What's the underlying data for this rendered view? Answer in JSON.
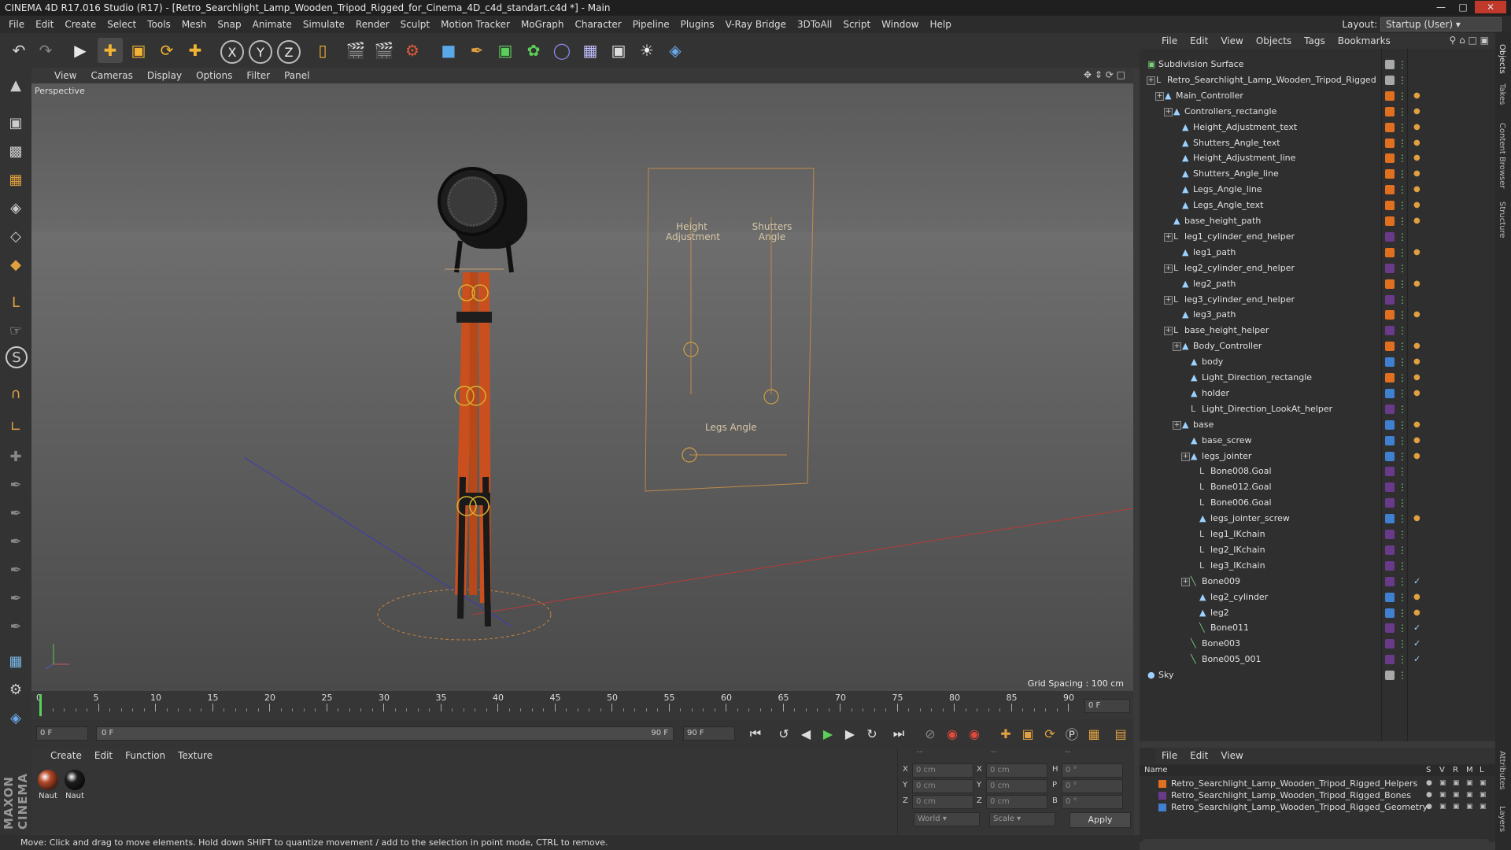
{
  "title": "CINEMA 4D R17.016 Studio (R17) - [Retro_Searchlight_Lamp_Wooden_Tripod_Rigged_for_Cinema_4D_c4d_standart.c4d *] - Main",
  "menubar": [
    "File",
    "Edit",
    "Create",
    "Select",
    "Tools",
    "Mesh",
    "Snap",
    "Animate",
    "Simulate",
    "Render",
    "Sculpt",
    "Motion Tracker",
    "MoGraph",
    "Character",
    "Pipeline",
    "Plugins",
    "V-Ray Bridge",
    "3DToAll",
    "Script",
    "Window",
    "Help"
  ],
  "layout": {
    "label": "Layout:",
    "value": "Startup (User)"
  },
  "viewport_menu": [
    "View",
    "Cameras",
    "Display",
    "Options",
    "Filter",
    "Panel"
  ],
  "viewport": {
    "label": "Perspective",
    "grid_spacing": "Grid Spacing : 100 cm",
    "overlay": {
      "height": "Height Adjustment",
      "shutters": "Shutters Angle",
      "legs": "Legs Angle"
    }
  },
  "timeline": {
    "ticks": [
      "0",
      "5",
      "10",
      "15",
      "20",
      "25",
      "30",
      "35",
      "40",
      "45",
      "50",
      "55",
      "60",
      "65",
      "70",
      "75",
      "80",
      "85",
      "90"
    ],
    "end_frame": "0 F",
    "start_field": "0 F",
    "range_start": "0 F",
    "range_end": "90 F",
    "max_field": "90 F"
  },
  "material_menu": [
    "Create",
    "Edit",
    "Function",
    "Texture"
  ],
  "materials": [
    {
      "name": "Naut",
      "color": "#b54a2a"
    },
    {
      "name": "Naut",
      "color": "#1d1d1d"
    }
  ],
  "coords": {
    "rows": [
      {
        "a": "X",
        "av": "0 cm",
        "b": "X",
        "bv": "0 cm",
        "c": "H",
        "cv": "0 °"
      },
      {
        "a": "Y",
        "av": "0 cm",
        "b": "Y",
        "bv": "0 cm",
        "c": "P",
        "cv": "0 °"
      },
      {
        "a": "Z",
        "av": "0 cm",
        "b": "Z",
        "bv": "0 cm",
        "c": "B",
        "cv": "0 °"
      }
    ],
    "header": [
      "--",
      "--",
      "--"
    ],
    "space": "World",
    "mode": "Scale",
    "apply": "Apply"
  },
  "status": "Move: Click and drag to move elements. Hold down SHIFT to quantize movement / add to the selection in point mode, CTRL to remove.",
  "object_menu": [
    "File",
    "Edit",
    "View",
    "Objects",
    "Tags",
    "Bookmarks"
  ],
  "objects": [
    {
      "name": "Subdivision Surface",
      "depth": 0,
      "icon": "subdiv",
      "color": "#a8a8a8"
    },
    {
      "name": "Retro_Searchlight_Lamp_Wooden_Tripod_Rigged",
      "depth": 1,
      "icon": "null",
      "color": "#a8a8a8"
    },
    {
      "name": "Main_Controller",
      "depth": 2,
      "icon": "spline",
      "color": "#e07020"
    },
    {
      "name": "Controllers_rectangle",
      "depth": 3,
      "icon": "spline",
      "color": "#e07020"
    },
    {
      "name": "Height_Adjustment_text",
      "depth": 4,
      "icon": "spline",
      "color": "#e07020"
    },
    {
      "name": "Shutters_Angle_text",
      "depth": 4,
      "icon": "spline",
      "color": "#e07020"
    },
    {
      "name": "Height_Adjustment_line",
      "depth": 4,
      "icon": "spline",
      "color": "#e07020"
    },
    {
      "name": "Shutters_Angle_line",
      "depth": 4,
      "icon": "spline",
      "color": "#e07020"
    },
    {
      "name": "Legs_Angle_line",
      "depth": 4,
      "icon": "spline",
      "color": "#e07020"
    },
    {
      "name": "Legs_Angle_text",
      "depth": 4,
      "icon": "spline",
      "color": "#e07020"
    },
    {
      "name": "base_height_path",
      "depth": 3,
      "icon": "spline",
      "color": "#e07020"
    },
    {
      "name": "leg1_cylinder_end_helper",
      "depth": 3,
      "icon": "null",
      "color": "#6a3a8a"
    },
    {
      "name": "leg1_path",
      "depth": 4,
      "icon": "spline",
      "color": "#e07020"
    },
    {
      "name": "leg2_cylinder_end_helper",
      "depth": 3,
      "icon": "null",
      "color": "#6a3a8a"
    },
    {
      "name": "leg2_path",
      "depth": 4,
      "icon": "spline",
      "color": "#e07020"
    },
    {
      "name": "leg3_cylinder_end_helper",
      "depth": 3,
      "icon": "null",
      "color": "#6a3a8a"
    },
    {
      "name": "leg3_path",
      "depth": 4,
      "icon": "spline",
      "color": "#e07020"
    },
    {
      "name": "base_height_helper",
      "depth": 3,
      "icon": "null",
      "color": "#6a3a8a"
    },
    {
      "name": "Body_Controller",
      "depth": 4,
      "icon": "spline",
      "color": "#e07020"
    },
    {
      "name": "body",
      "depth": 5,
      "icon": "poly",
      "color": "#4080d0"
    },
    {
      "name": "Light_Direction_rectangle",
      "depth": 5,
      "icon": "spline",
      "color": "#e07020"
    },
    {
      "name": "holder",
      "depth": 5,
      "icon": "poly",
      "color": "#4080d0"
    },
    {
      "name": "Light_Direction_LookAt_helper",
      "depth": 5,
      "icon": "null",
      "color": "#6a3a8a"
    },
    {
      "name": "base",
      "depth": 4,
      "icon": "poly",
      "color": "#4080d0"
    },
    {
      "name": "base_screw",
      "depth": 5,
      "icon": "poly",
      "color": "#4080d0"
    },
    {
      "name": "legs_jointer",
      "depth": 5,
      "icon": "poly",
      "color": "#4080d0"
    },
    {
      "name": "Bone008.Goal",
      "depth": 6,
      "icon": "null",
      "color": "#6a3a8a"
    },
    {
      "name": "Bone012.Goal",
      "depth": 6,
      "icon": "null",
      "color": "#6a3a8a"
    },
    {
      "name": "Bone006.Goal",
      "depth": 6,
      "icon": "null",
      "color": "#6a3a8a"
    },
    {
      "name": "legs_jointer_screw",
      "depth": 6,
      "icon": "poly",
      "color": "#4080d0"
    },
    {
      "name": "leg1_IKchain",
      "depth": 6,
      "icon": "null",
      "color": "#6a3a8a"
    },
    {
      "name": "leg2_IKchain",
      "depth": 6,
      "icon": "null",
      "color": "#6a3a8a"
    },
    {
      "name": "leg3_IKchain",
      "depth": 6,
      "icon": "null",
      "color": "#6a3a8a"
    },
    {
      "name": "Bone009",
      "depth": 5,
      "icon": "bone",
      "color": "#6a3a8a"
    },
    {
      "name": "leg2_cylinder",
      "depth": 6,
      "icon": "poly",
      "color": "#4080d0"
    },
    {
      "name": "leg2",
      "depth": 6,
      "icon": "poly",
      "color": "#4080d0"
    },
    {
      "name": "Bone011",
      "depth": 6,
      "icon": "bone",
      "color": "#6a3a8a"
    },
    {
      "name": "Bone003",
      "depth": 5,
      "icon": "bone",
      "color": "#6a3a8a"
    },
    {
      "name": "Bone005_001",
      "depth": 5,
      "icon": "bone",
      "color": "#6a3a8a"
    },
    {
      "name": "Sky",
      "depth": 0,
      "icon": "sky",
      "color": "#a8a8a8"
    }
  ],
  "layer_menu": [
    "File",
    "Edit",
    "View"
  ],
  "layer_header": {
    "name": "Name",
    "cols": [
      "S",
      "V",
      "R",
      "M",
      "L"
    ]
  },
  "layers": [
    {
      "name": "Retro_Searchlight_Lamp_Wooden_Tripod_Rigged_Helpers",
      "color": "#e07020"
    },
    {
      "name": "Retro_Searchlight_Lamp_Wooden_Tripod_Rigged_Bones",
      "color": "#6a3a8a"
    },
    {
      "name": "Retro_Searchlight_Lamp_Wooden_Tripod_Rigged_Geometry",
      "color": "#4080d0"
    }
  ],
  "side_tabs": [
    "Objects",
    "Takes",
    "Content Browser",
    "Structure"
  ],
  "side_tabs_bottom": [
    "Attributes",
    "Layers"
  ],
  "brand": "MAXON CINEMA 4D"
}
